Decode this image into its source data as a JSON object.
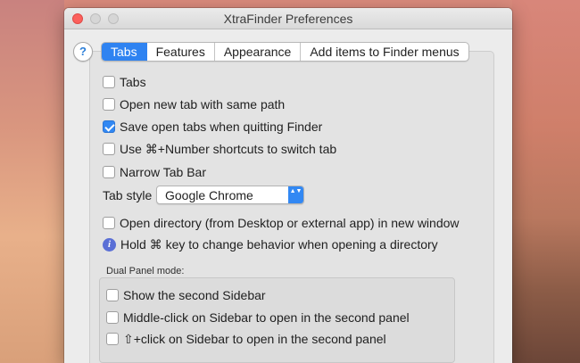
{
  "window": {
    "title": "XtraFinder Preferences"
  },
  "help": {
    "label": "?"
  },
  "tabs": [
    {
      "label": "Tabs",
      "active": true
    },
    {
      "label": "Features",
      "active": false
    },
    {
      "label": "Appearance",
      "active": false
    },
    {
      "label": "Add items to Finder menus",
      "active": false
    }
  ],
  "options": {
    "tabs": {
      "label": "Tabs",
      "checked": false
    },
    "open_new_tab": {
      "label": "Open new tab with same path",
      "checked": false
    },
    "save_open_tabs": {
      "label": "Save open tabs when quitting Finder",
      "checked": true
    },
    "cmd_number": {
      "label": "Use ⌘+Number shortcuts to switch tab",
      "checked": false
    },
    "narrow_tab_bar": {
      "label": "Narrow Tab Bar",
      "checked": false
    },
    "open_directory": {
      "label": "Open directory (from Desktop or external app) in new window",
      "checked": false
    }
  },
  "tab_style": {
    "label": "Tab style",
    "value": "Google Chrome",
    "arrows": "▲▼"
  },
  "info": {
    "icon": "i",
    "text": "Hold ⌘ key to change behavior when opening a directory"
  },
  "dual_panel": {
    "heading": "Dual Panel mode:",
    "show_second_sidebar": {
      "label": "Show the second Sidebar",
      "checked": false
    },
    "middle_click": {
      "label": "Middle-click on Sidebar to open in the second panel",
      "checked": false
    },
    "shift_click": {
      "label": "⇧+click on Sidebar to open in the second panel",
      "checked": false
    }
  },
  "colors": {
    "accent": "#2f83f1",
    "close": "#fc605c",
    "info_icon": "#5a6fd6"
  }
}
